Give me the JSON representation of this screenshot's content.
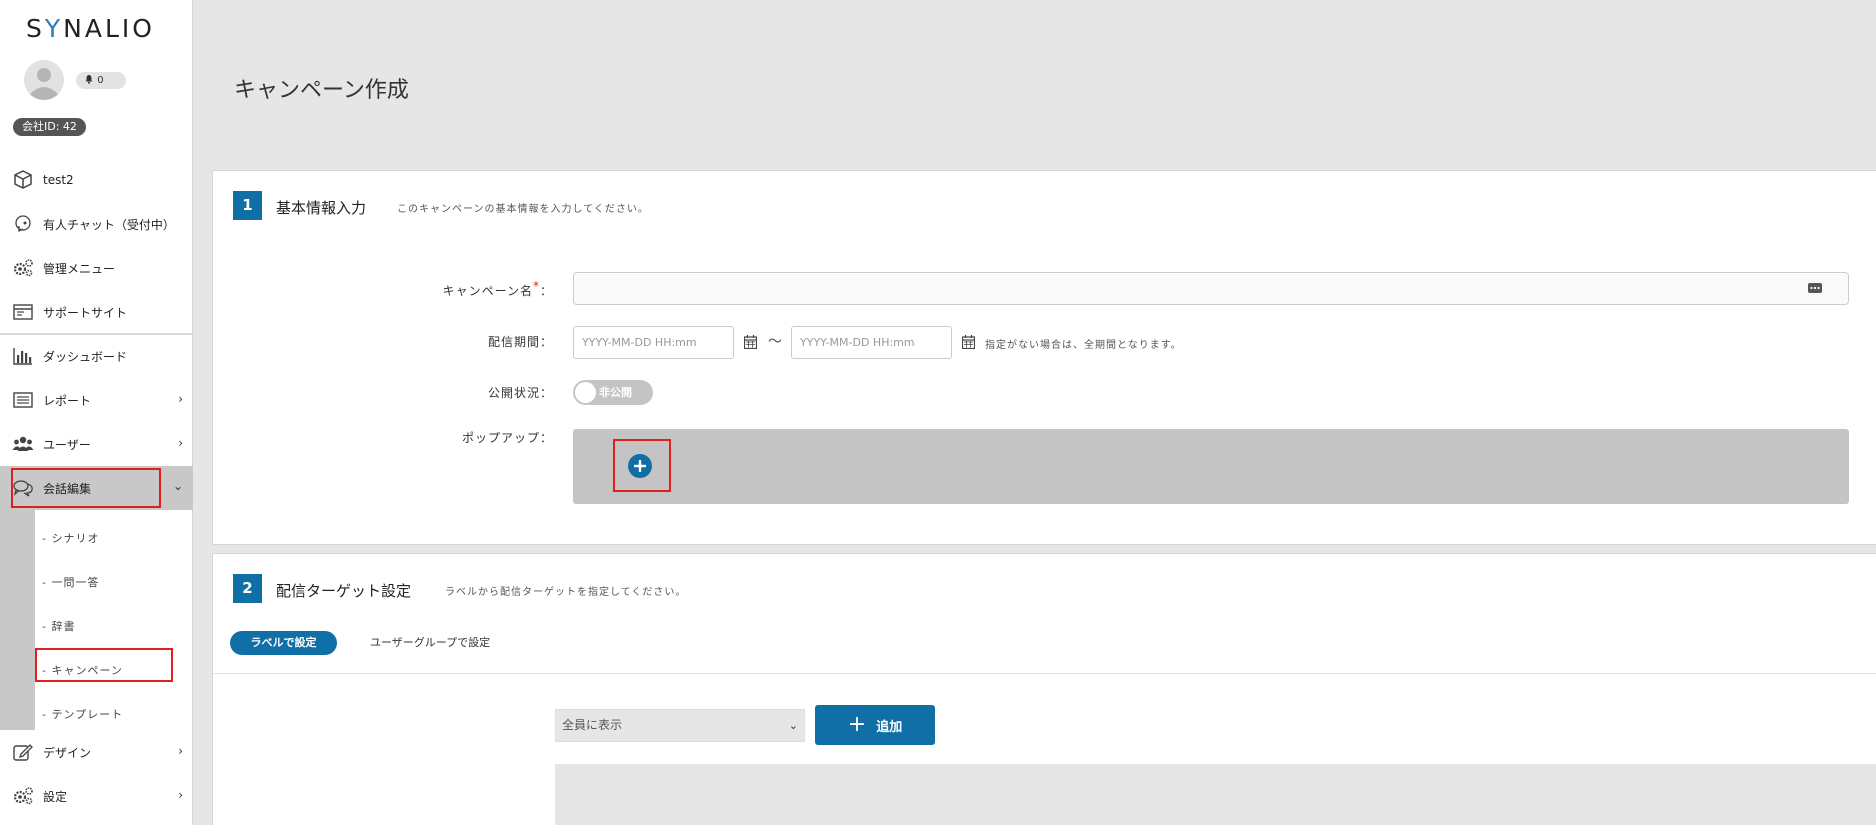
{
  "sidebar": {
    "logo": "SYNALIO",
    "logo_pre": "S",
    "logo_accent": "Y",
    "logo_post": "NALIO",
    "notification_count": "0",
    "company_id": "会社ID: 42",
    "items": [
      {
        "label": "test2",
        "icon": "box-icon"
      },
      {
        "label": "有人チャット（受付中）",
        "icon": "headset-icon"
      },
      {
        "label": "管理メニュー",
        "icon": "gears-icon"
      },
      {
        "label": "サポートサイト",
        "icon": "browser-window-icon"
      },
      {
        "label": "ダッシュボード",
        "icon": "bar-chart-icon"
      },
      {
        "label": "レポート",
        "icon": "list-icon"
      },
      {
        "label": "ユーザー",
        "icon": "users-icon"
      },
      {
        "label": "会話編集",
        "icon": "chat-bubbles-icon"
      },
      {
        "label": "デザイン",
        "icon": "edit-icon"
      },
      {
        "label": "設定",
        "icon": "gears-icon"
      }
    ],
    "sub_items": [
      "-  シナリオ",
      "-  一問一答",
      "-  辞書",
      "-  キャンペーン",
      "-  テンプレート"
    ]
  },
  "page": {
    "title": "キャンペーン作成"
  },
  "section1": {
    "step": "1",
    "title": "基本情報入力",
    "description": "このキャンペーンの基本情報を入力してください。",
    "fields": {
      "campaign_name_label": "キャンペーン名",
      "required_mark": "*",
      "colon": "：",
      "period_label": "配信期間：",
      "start_placeholder": "YYYY-MM-DD HH:mm",
      "tilde": "〜",
      "end_placeholder": "YYYY-MM-DD HH:mm",
      "period_note": "指定がない場合は、全期間となります。",
      "status_label": "公開状況：",
      "status_value": "非公開",
      "popup_label": "ポップアップ："
    }
  },
  "section2": {
    "step": "2",
    "title": "配信ターゲット設定",
    "description": "ラベルから配信ターゲットを指定してください。",
    "tabs": [
      "ラベルで設定",
      "ユーザーグループで設定"
    ],
    "select_value": "全員に表示",
    "add_label": "追加"
  },
  "colors": {
    "accent": "#0f6fa6",
    "highlight": "#e0201c",
    "background": "#e6e6e6"
  }
}
